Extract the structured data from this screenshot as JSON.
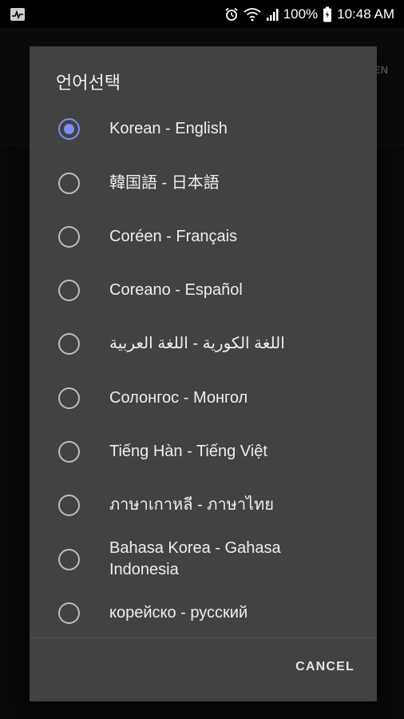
{
  "status_bar": {
    "battery_percent": "100%",
    "time": "10:48 AM",
    "icons": [
      "activity-icon",
      "alarm-icon",
      "wifi-icon",
      "signal-icon",
      "battery-icon"
    ]
  },
  "app_bar": {
    "lang_label": "EN",
    "icons": [
      "search-list-icon",
      "link-icon"
    ]
  },
  "dialog": {
    "title": "언어선택",
    "selected_index": 0,
    "options": [
      {
        "label": "Korean - English"
      },
      {
        "label": "韓国語 - 日本語"
      },
      {
        "label": "Coréen - Français"
      },
      {
        "label": "Coreano - Español"
      },
      {
        "label": "اللغة الكورية - اللغة العربية"
      },
      {
        "label": "Солонгос - Монгол"
      },
      {
        "label": "Tiếng Hàn - Tiếng Việt"
      },
      {
        "label": "ภาษาเกาหลี - ภาษาไทย"
      },
      {
        "label": "Bahasa Korea - Gahasa Indonesia"
      },
      {
        "label": "корейско - русский"
      }
    ],
    "cancel_label": "CANCEL"
  },
  "colors": {
    "accent": "#7c8ff2",
    "dialog_bg": "#424242",
    "screen_bg": "#0d0d0d"
  }
}
